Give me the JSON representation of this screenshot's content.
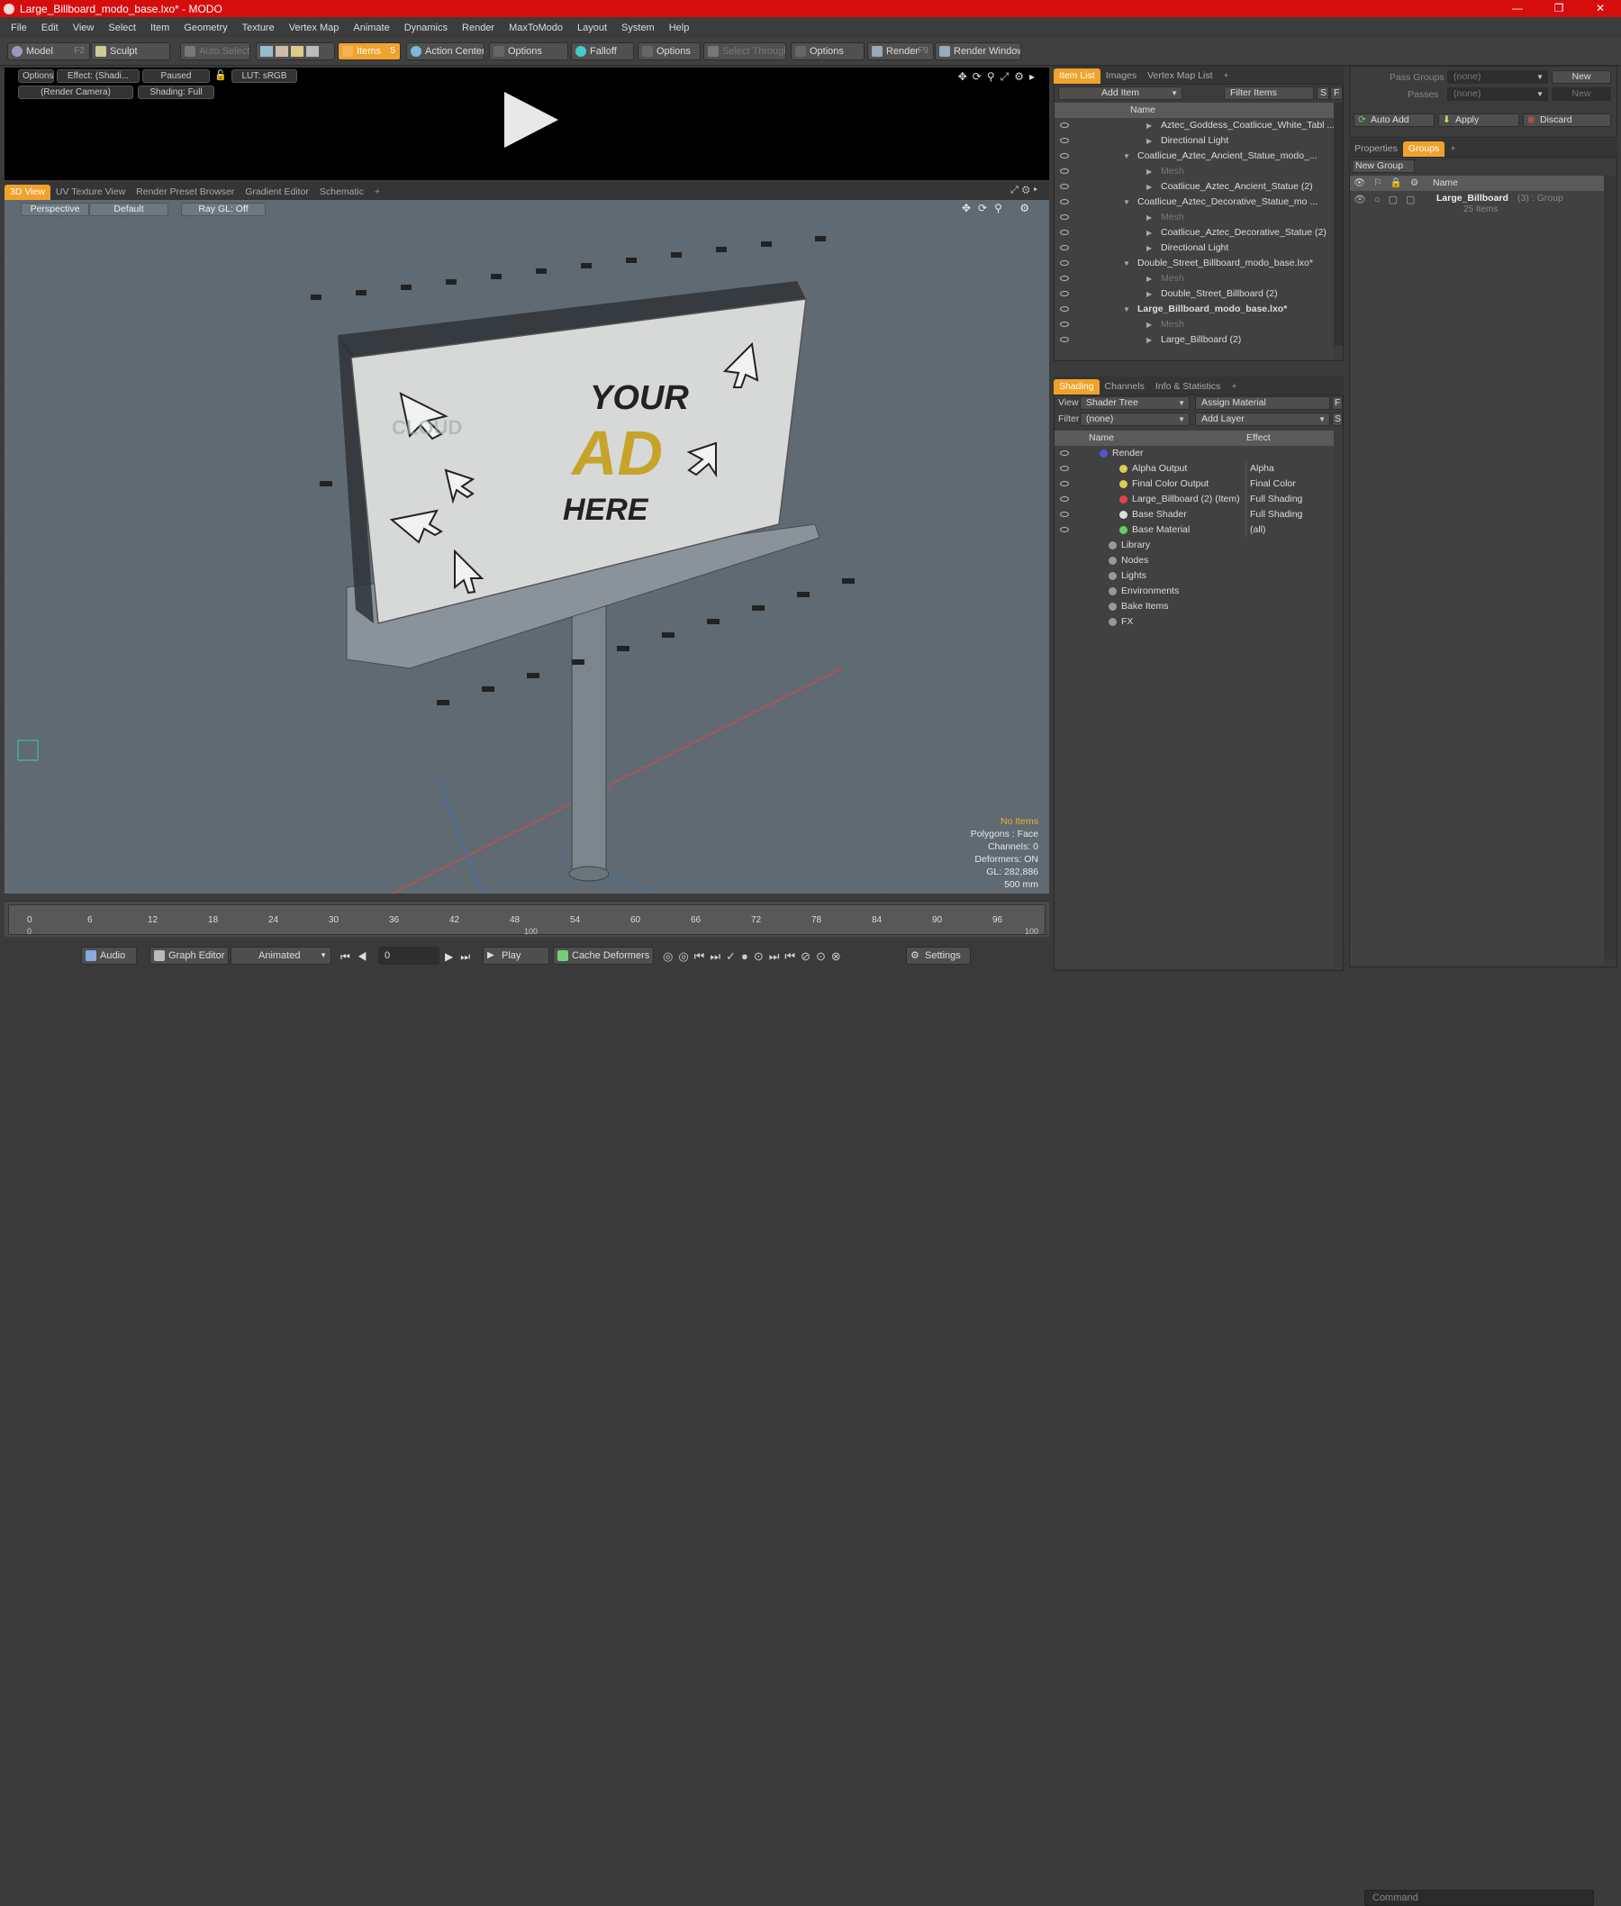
{
  "window": {
    "title": "Large_Billboard_modo_base.lxo* - MODO",
    "min": "—",
    "max": "❐",
    "close": "✕"
  },
  "menu": [
    "File",
    "Edit",
    "View",
    "Select",
    "Item",
    "Geometry",
    "Texture",
    "Vertex Map",
    "Animate",
    "Dynamics",
    "Render",
    "MaxToModo",
    "Layout",
    "System",
    "Help"
  ],
  "toolbar": {
    "model": "Model",
    "model_key": "F2",
    "sculpt": "Sculpt",
    "auto_select": "Auto Select",
    "items": "Items",
    "items_key": "5",
    "action_center": "Action Center",
    "options1": "Options",
    "falloff": "Falloff",
    "options2": "Options",
    "select_through": "Select Through",
    "options3": "Options",
    "render": "Render",
    "render_key": "F9",
    "render_window": "Render Window"
  },
  "preview": {
    "options": "Options",
    "effect": "Effect: (Shadi...",
    "paused": "Paused",
    "lut": "LUT: sRGB",
    "camera": "(Render Camera)",
    "shading": "Shading: Full"
  },
  "view_tabs": [
    "3D View",
    "UV Texture View",
    "Render Preset Browser",
    "Gradient Editor",
    "Schematic",
    "+"
  ],
  "viewport": {
    "perspective": "Perspective",
    "default": "Default",
    "raygl": "Ray GL: Off",
    "billboard_line1": "YOUR",
    "billboard_line2": "AD",
    "billboard_line3": "HERE",
    "watermark": "CLOUD",
    "stats": {
      "no_items": "No Items",
      "polygons": "Polygons : Face",
      "channels": "Channels: 0",
      "deformers": "Deformers: ON",
      "gl": "GL: 282,886",
      "unit": "500 mm"
    }
  },
  "timeline": {
    "ticks": [
      "0",
      "6",
      "12",
      "18",
      "24",
      "30",
      "36",
      "42",
      "48",
      "54",
      "60",
      "66",
      "72",
      "78",
      "84",
      "90",
      "96"
    ],
    "sub_start": "0",
    "sub_mid": "100",
    "sub_end": "100"
  },
  "bottom": {
    "audio": "Audio",
    "graph_editor": "Graph Editor",
    "animated": "Animated",
    "frame": "0",
    "play": "Play",
    "cache": "Cache Deformers",
    "settings": "Settings",
    "command": "Command"
  },
  "itemlist": {
    "tabs": [
      "Item List",
      "Images",
      "Vertex Map List",
      "+"
    ],
    "add_item": "Add Item",
    "filter": "Filter Items",
    "s": "S",
    "f": "F",
    "name_col": "Name",
    "rows": [
      {
        "label": "Aztec_Goddess_Coatlicue_White_Tabl ...",
        "indent": 40,
        "dim": false
      },
      {
        "label": "Directional Light",
        "indent": 40,
        "dim": false
      },
      {
        "label": "Coatlicue_Aztec_Ancient_Statue_modo_...",
        "indent": 14,
        "dim": false
      },
      {
        "label": "Mesh",
        "indent": 40,
        "dim": true
      },
      {
        "label": "Coatlicue_Aztec_Ancient_Statue (2)",
        "indent": 40,
        "dim": false
      },
      {
        "label": "Coatlicue_Aztec_Decorative_Statue_mo ...",
        "indent": 14,
        "dim": false
      },
      {
        "label": "Mesh",
        "indent": 40,
        "dim": true
      },
      {
        "label": "Coatlicue_Aztec_Decorative_Statue (2)",
        "indent": 40,
        "dim": false
      },
      {
        "label": "Directional Light",
        "indent": 40,
        "dim": false
      },
      {
        "label": "Double_Street_Billboard_modo_base.lxo*",
        "indent": 14,
        "dim": false
      },
      {
        "label": "Mesh",
        "indent": 40,
        "dim": true
      },
      {
        "label": "Double_Street_Billboard (2)",
        "indent": 40,
        "dim": false
      },
      {
        "label": "Large_Billboard_modo_base.lxo*",
        "indent": 14,
        "dim": false
      },
      {
        "label": "Mesh",
        "indent": 40,
        "dim": true
      },
      {
        "label": "Large_Billboard (2)",
        "indent": 40,
        "dim": false
      }
    ]
  },
  "shading": {
    "tabs": [
      "Shading",
      "Channels",
      "Info & Statistics",
      "+"
    ],
    "view_label": "View",
    "view_value": "Shader Tree",
    "assign": "Assign Material",
    "f": "F",
    "filter_label": "Filter",
    "filter_value": "(none)",
    "add_layer": "Add Layer",
    "s": "S",
    "name_col": "Name",
    "effect_col": "Effect",
    "rows": [
      {
        "label": "Render",
        "effect": "",
        "indent": 30
      },
      {
        "label": "Alpha Output",
        "effect": "Alpha",
        "indent": 52
      },
      {
        "label": "Final Color Output",
        "effect": "Final Color",
        "indent": 52
      },
      {
        "label": "Large_Billboard (2) (Item)",
        "effect": "Full Shading",
        "indent": 52
      },
      {
        "label": "Base Shader",
        "effect": "Full Shading",
        "indent": 52
      },
      {
        "label": "Base Material",
        "effect": "(all)",
        "indent": 52
      },
      {
        "label": "Library",
        "effect": "",
        "indent": 40
      },
      {
        "label": "Nodes",
        "effect": "",
        "indent": 40
      },
      {
        "label": "Lights",
        "effect": "",
        "indent": 40
      },
      {
        "label": "Environments",
        "effect": "",
        "indent": 40
      },
      {
        "label": "Bake Items",
        "effect": "",
        "indent": 40
      },
      {
        "label": "FX",
        "effect": "",
        "indent": 40
      }
    ]
  },
  "groups": {
    "pass_groups": "Pass Groups",
    "passes": "Passes",
    "none": "(none)",
    "new": "New",
    "auto_add": "Auto Add",
    "apply": "Apply",
    "discard": "Discard",
    "tabs": [
      "Properties",
      "Groups",
      "+"
    ],
    "new_group": "New Group",
    "name_col": "Name",
    "group_name": "Large_Billboard",
    "group_meta": "(3) : Group",
    "group_items": "25 Items"
  },
  "colors": {
    "accent": "#f0a22c",
    "title": "#d60d0d",
    "viewport": "#5f6a72"
  }
}
